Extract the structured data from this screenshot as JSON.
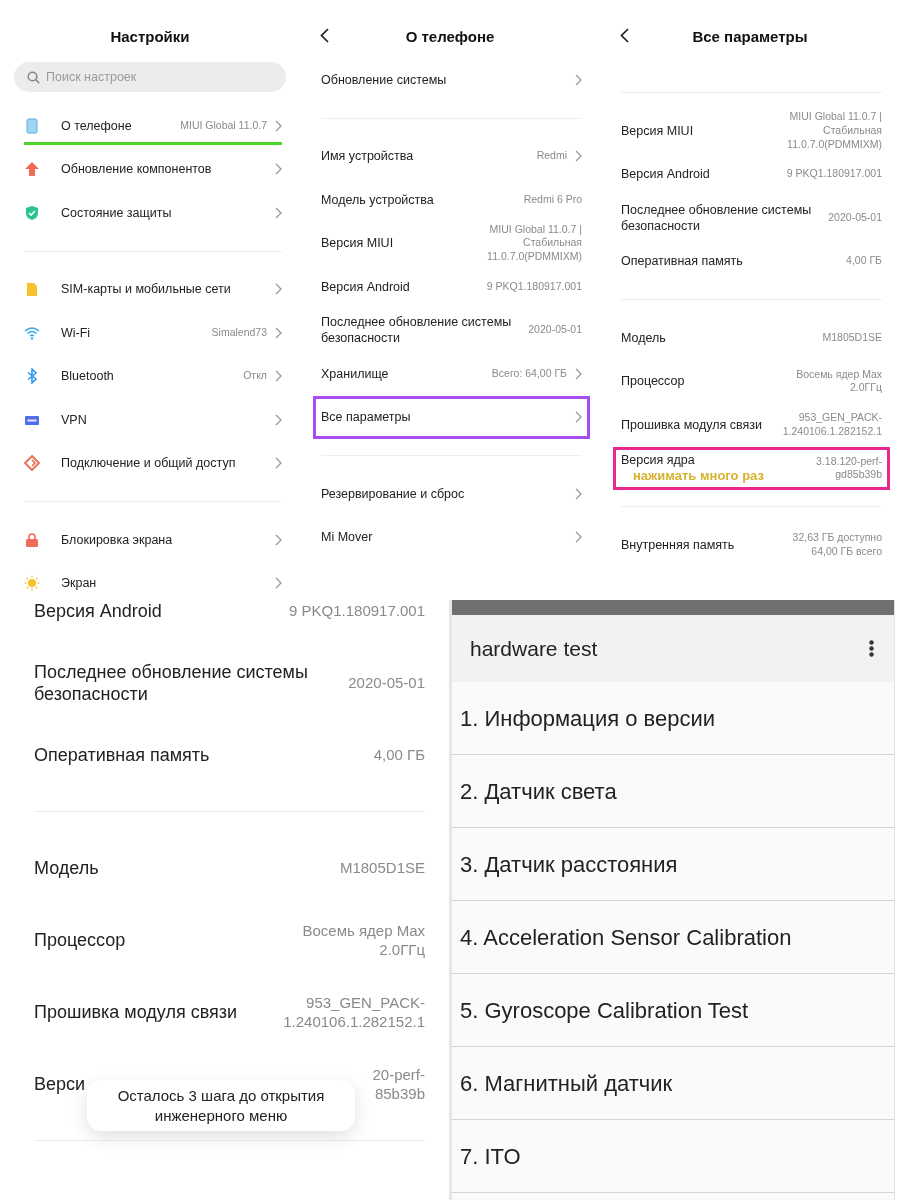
{
  "settings_screen": {
    "title": "Настройки",
    "search": {
      "placeholder": "Поиск настроек"
    },
    "groups": [
      {
        "items": [
          {
            "label": "О телефоне",
            "value": "MIUI Global 11.0.7",
            "chevron": true,
            "annotation": {
              "kind": "underline",
              "color": "#4cd62a"
            }
          },
          {
            "label": "Обновление компонентов",
            "chevron": true
          },
          {
            "label": "Состояние защиты",
            "chevron": true
          }
        ]
      },
      {
        "items": [
          {
            "label": "SIM-карты и мобильные сети",
            "chevron": true
          },
          {
            "label": "Wi-Fi",
            "value": "Simalend73",
            "chevron": true
          },
          {
            "label": "Bluetooth",
            "value": "Откл",
            "chevron": true
          },
          {
            "label": "VPN",
            "chevron": true
          },
          {
            "label": "Подключение и общий доступ",
            "chevron": true
          }
        ]
      },
      {
        "items": [
          {
            "label": "Блокировка экрана",
            "chevron": true
          },
          {
            "label": "Экран",
            "chevron": true
          }
        ]
      }
    ]
  },
  "about_screen": {
    "title": "О телефоне",
    "groups": [
      {
        "items": [
          {
            "label": "Обновление системы",
            "chevron": true
          }
        ]
      },
      {
        "items": [
          {
            "label": "Имя устройства",
            "value": "Redmi",
            "chevron": true
          },
          {
            "label": "Модель устройства",
            "value": "Redmi 6 Pro",
            "chevron": false
          },
          {
            "label": "Версия MIUI",
            "value": "MIUI Global 11.0.7 |\nСтабильная\n11.0.7.0(PDMMIXM)",
            "chevron": false
          },
          {
            "label": "Версия Android",
            "value": "9 PKQ1.180917.001",
            "chevron": false
          },
          {
            "label": "Последнее обновление системы безопасности",
            "value": "2020-05-01",
            "chevron": false
          },
          {
            "label": "Хранилище",
            "value": "Всего: 64,00 ГБ",
            "chevron": true
          },
          {
            "label": "Все параметры",
            "chevron": true,
            "annotation": {
              "kind": "box",
              "color": "#a64cf0"
            }
          }
        ]
      },
      {
        "items": [
          {
            "label": "Резервирование и сброс",
            "chevron": true
          },
          {
            "label": "Mi Mover",
            "chevron": true
          }
        ]
      }
    ]
  },
  "all_params_screen": {
    "title": "Все параметры",
    "groups": [
      {
        "items": [
          {
            "label": "Версия MIUI",
            "value": "MIUI Global 11.0.7 |\nСтабильная\n11.0.7.0(PDMMIXM)",
            "chevron": false
          },
          {
            "label": "Версия Android",
            "value": "9 PKQ1.180917.001",
            "chevron": false
          },
          {
            "label": "Последнее обновление системы безопасности",
            "value": "2020-05-01",
            "chevron": false
          },
          {
            "label": "Оперативная память",
            "value": "4,00 ГБ",
            "chevron": false
          }
        ]
      },
      {
        "items": [
          {
            "label": "Модель",
            "value": "M1805D1SE",
            "chevron": false
          },
          {
            "label": "Процессор",
            "value": "Восемь ядер Max\n2.0ГГц",
            "chevron": false
          },
          {
            "label": "Прошивка модуля связи",
            "value": "953_GEN_PACK-\n1.240106.1.282152.1",
            "chevron": false
          },
          {
            "label": "Версия ядра",
            "value": "3.18.120-perf-\ngd85b39b",
            "chevron": false,
            "annotation": {
              "kind": "box",
              "color": "#e8288c",
              "note": "нажимать много раз"
            }
          }
        ]
      },
      {
        "items": [
          {
            "label": "Внутренняя память",
            "value": "32,63 ГБ доступно\n64,00 ГБ всего",
            "chevron": false
          }
        ]
      }
    ]
  },
  "zoomed_screen": {
    "groups": [
      {
        "items": [
          {
            "label": "Версия Android",
            "value": "9 PKQ1.180917.001",
            "chevron": false
          },
          {
            "label": "Последнее обновление системы безопасности",
            "value": "2020-05-01",
            "chevron": false
          },
          {
            "label": "Оперативная память",
            "value": "4,00 ГБ",
            "chevron": false
          }
        ]
      },
      {
        "items": [
          {
            "label": "Модель",
            "value": "M1805D1SE",
            "chevron": false
          },
          {
            "label": "Процессор",
            "value": "Восемь ядер Max\n2.0ГГц",
            "chevron": false
          },
          {
            "label": "Прошивка модуля связи",
            "value": "953_GEN_PACK-\n1.240106.1.282152.1",
            "chevron": false
          },
          {
            "label": "Верси",
            "value": "20-perf-\n85b39b",
            "chevron": false
          }
        ]
      }
    ],
    "toast": {
      "text": "Осталось 3 шага до открытия\nинженерного меню"
    }
  },
  "hardware_test": {
    "title": "hardware test",
    "items": [
      "1. Информация о версии",
      "2. Датчик света",
      "3. Датчик расстояния",
      "4. Acceleration Sensor Calibration",
      "5. Gyroscope Calibration Test",
      "6. Магнитный датчик",
      "7. ITO"
    ]
  }
}
